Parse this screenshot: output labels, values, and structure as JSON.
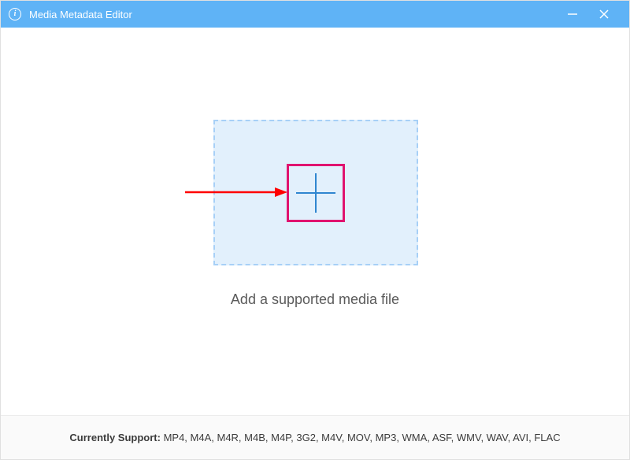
{
  "titlebar": {
    "app_icon_glyph": "i",
    "title": "Media Metadata Editor"
  },
  "dropzone": {
    "add_icon": "plus",
    "prompt": "Add a supported media file"
  },
  "footer": {
    "support_label": "Currently Support:",
    "formats": "MP4, M4A, M4R, M4B, M4P, 3G2, M4V, MOV, MP3, WMA, ASF, WMV, WAV, AVI, FLAC"
  },
  "annotation": {
    "arrow_color": "#ff0000",
    "highlight_color": "#e0136f"
  }
}
